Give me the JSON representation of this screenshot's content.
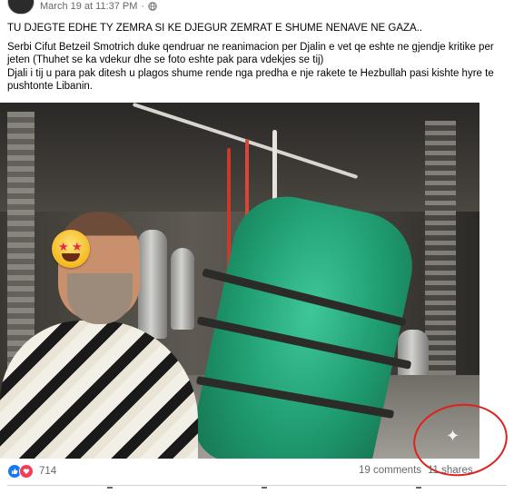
{
  "post": {
    "timestamp": "March 19 at 11:37 PM",
    "separator": "·",
    "title": "TU DJEGTE EDHE TY ZEMRA SI KE DJEGUR ZEMRAT E SHUME NENAVE NE GAZA..",
    "body_line1": "Serbi Cifut Betzeil Smotrich duke qendruar ne reanimacion per Djalin e vet qe eshte ne gjendje kritike per jeten (Thuhet se ka vdekur dhe se foto eshte pak para vdekjes se tij)",
    "body_line2": "Djali i tij u para pak ditesh u plagos shume rende nga predha e nje rakete te Hezbullah pasi kishte hyre te pushtonte Libanin."
  },
  "photo": {
    "emoji": "star-struck-emoji",
    "overlay_icon": "sparkle-icon",
    "annotation_color": "#e0201c"
  },
  "footer": {
    "reaction_icons": [
      "like-icon",
      "love-icon"
    ],
    "reaction_count": "714",
    "comments": "19 comments",
    "shares": "11 shares"
  },
  "colors": {
    "text": "#050505",
    "secondary_text": "#65676b",
    "like": "#1877f2",
    "love": "#f33e58"
  }
}
